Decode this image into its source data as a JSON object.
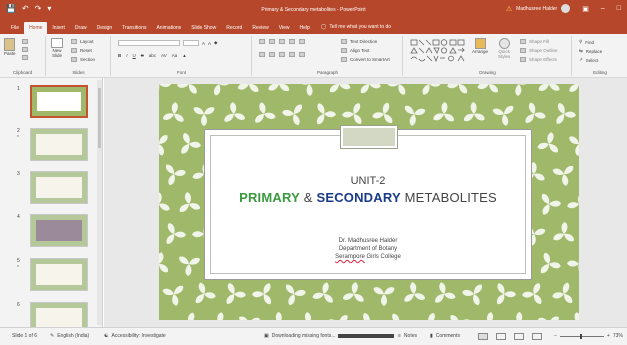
{
  "window": {
    "title": "Primary & Secondary metabolites - PowerPoint",
    "user": "Madhusree Halder",
    "quick_access": [
      "save-icon",
      "undo-icon",
      "redo-icon",
      "customize-icon"
    ]
  },
  "tabs": [
    "File",
    "Home",
    "Insert",
    "Draw",
    "Design",
    "Transitions",
    "Animations",
    "Slide Show",
    "Record",
    "Review",
    "View",
    "Help"
  ],
  "active_tab": "Home",
  "tellme": "Tell me what you want to do",
  "ribbon": {
    "clipboard": {
      "label": "Clipboard",
      "paste": "Paste"
    },
    "slides": {
      "label": "Slides",
      "new_slide_1": "New",
      "new_slide_2": "Slide",
      "layout": "Layout",
      "reset": "Reset",
      "section": "Section"
    },
    "font": {
      "label": "Font",
      "size": "",
      "bold": "B",
      "italic": "I",
      "underline": "U",
      "strike": "S",
      "abc": "abc",
      "spacing": "AV",
      "case": "Aa",
      "grow": "A",
      "shrink": "A"
    },
    "paragraph": {
      "label": "Paragraph",
      "text_direction": "Text Direction",
      "align_text": "Align Text",
      "smartart": "Convert to SmartArt"
    },
    "drawing": {
      "label": "Drawing",
      "arrange": "Arrange",
      "quick_styles_1": "Quick",
      "quick_styles_2": "Styles",
      "shape_fill": "Shape Fill",
      "shape_outline": "Shape Outline",
      "shape_effects": "Shape Effects"
    },
    "editing": {
      "label": "Editing",
      "find": "Find",
      "replace": "Replace",
      "select": "Select"
    }
  },
  "thumbnails": [
    {
      "num": "1",
      "star": "",
      "active": true
    },
    {
      "num": "2",
      "star": "*",
      "active": false
    },
    {
      "num": "3",
      "star": "",
      "active": false
    },
    {
      "num": "4",
      "star": "",
      "active": false
    },
    {
      "num": "5",
      "star": "*",
      "active": false
    },
    {
      "num": "6",
      "star": "",
      "active": false
    }
  ],
  "slide": {
    "unit": "UNIT-2",
    "word1": "PRIMARY",
    "amp": " & ",
    "word2": "SECONDARY",
    "word3": " METABOLITES",
    "author_line1": "Dr. Madhusree Halder",
    "author_line2": "Department of Botany",
    "author_line3a": "Serampore",
    "author_line3b": " Girls College",
    "colors": {
      "background": "#9fb86a",
      "leaf": "#ffffff",
      "primary": "#3a9a3e",
      "secondary": "#1a3a8a"
    }
  },
  "status": {
    "slide_of": "Slide 1 of 6",
    "language": "English (India)",
    "accessibility": "Accessibility: Investigate",
    "downloading": "Downloading missing fonts...",
    "notes": "Notes",
    "comments": "Comments",
    "zoom": "73%"
  }
}
